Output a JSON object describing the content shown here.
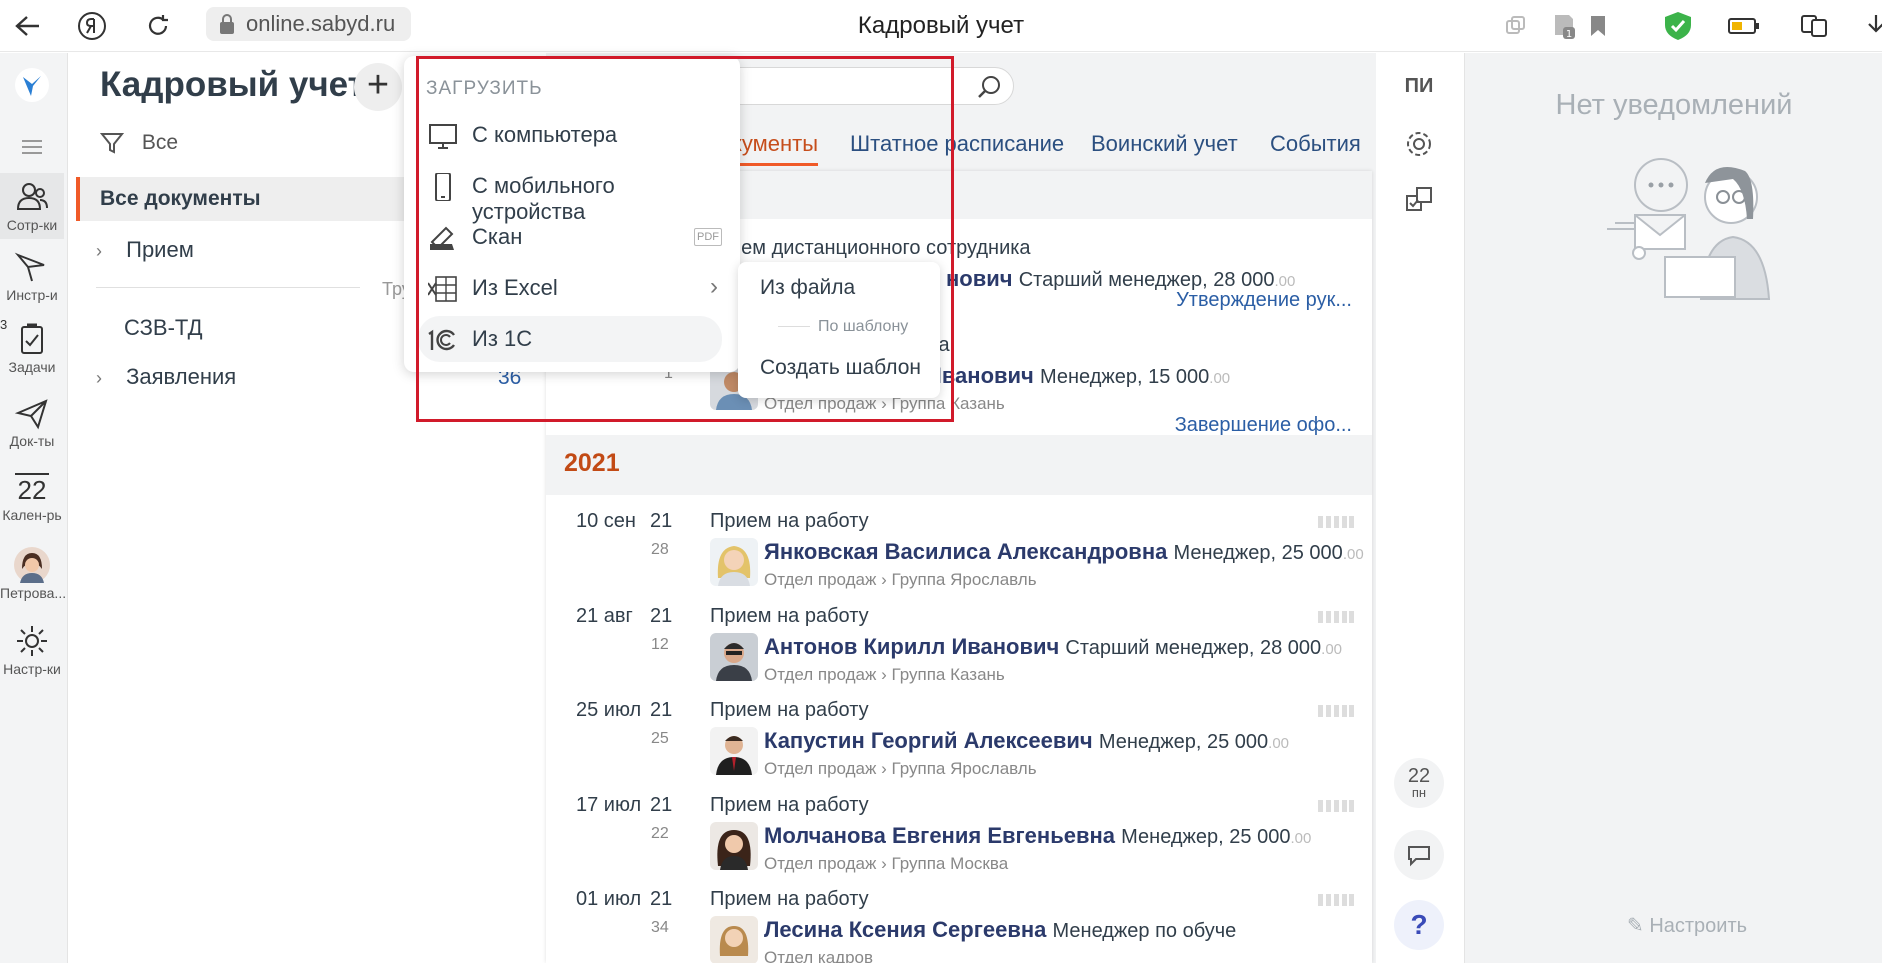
{
  "browser": {
    "url": "online.sabyd.ru",
    "title": "Кадровый учет"
  },
  "nav": {
    "items": [
      {
        "label": "Сотр-ки"
      },
      {
        "label": "Инстр-и"
      },
      {
        "label": "Задачи",
        "badge": "3"
      },
      {
        "label": "Док-ты"
      },
      {
        "label": "Кален-рь",
        "day": "22"
      },
      {
        "label": "Петрова..."
      },
      {
        "label": "Настр-ки"
      }
    ]
  },
  "sidebar": {
    "title": "Кадровый учет",
    "add_label": "+",
    "filter_label": "Все",
    "items": [
      {
        "label": "Все документы",
        "active": true
      },
      {
        "label": "Прием"
      },
      {
        "label": "СЗВ-ТД"
      },
      {
        "label": "Заявления",
        "count": "36"
      }
    ],
    "cut_label": "Тру"
  },
  "main": {
    "tabs": [
      {
        "label": "кументы",
        "active": true
      },
      {
        "label": "Штатное расписание"
      },
      {
        "label": "Воинский учет"
      },
      {
        "label": "События"
      }
    ],
    "top_rows": [
      {
        "type": "ием дистанционного сотрудника",
        "name": "нович",
        "position": "Старший менеджер, 28 000",
        "cents": ".00",
        "status": "Утверждение рук..."
      },
      {
        "type": "трудника",
        "number": "1",
        "name": "Иванович",
        "position": "Менеджер, 15 000",
        "cents": ".00",
        "dept": "Отдел продаж",
        "group": "Группа Казань",
        "status": "Завершение офо..."
      }
    ],
    "year": "2021",
    "documents": [
      {
        "date": "10 сен",
        "yr": "21",
        "num": "28",
        "type": "Прием на работу",
        "name": "Янковская Василиса Александровна",
        "position": "Менеджер, 25 000",
        "cents": ".00",
        "dept": "Отдел продаж",
        "group": "Группа Ярославль"
      },
      {
        "date": "21 авг",
        "yr": "21",
        "num": "12",
        "type": "Прием на работу",
        "name": "Антонов Кирилл Иванович",
        "position": "Старший менеджер, 28 000",
        "cents": ".00",
        "dept": "Отдел продаж",
        "group": "Группа Казань"
      },
      {
        "date": "25 июл",
        "yr": "21",
        "num": "25",
        "type": "Прием на работу",
        "name": "Капустин Георгий Алексеевич",
        "position": "Менеджер, 25 000",
        "cents": ".00",
        "dept": "Отдел продаж",
        "group": "Группа Ярославль"
      },
      {
        "date": "17 июл",
        "yr": "21",
        "num": "22",
        "type": "Прием на работу",
        "name": "Молчанова Евгения Евгеньевна",
        "position": "Менеджер, 25 000",
        "cents": ".00",
        "dept": "Отдел продаж",
        "group": "Группа Москва"
      },
      {
        "date": "01 июл",
        "yr": "21",
        "num": "34",
        "type": "Прием на работу",
        "name": "Лесина Ксения Сергеевна",
        "position": "Менеджер по обуче",
        "cents": "",
        "dept": "Отдел кадров",
        "group": ""
      }
    ]
  },
  "right_tools": {
    "user_initials": "ПИ",
    "calendar_day": "22",
    "calendar_weekday": "пн",
    "help_label": "?"
  },
  "notifications": {
    "empty_title": "Нет уведомлений",
    "configure_label": "Настроить"
  },
  "upload_menu": {
    "header": "ЗАГРУЗИТЬ",
    "items": [
      {
        "label": "С компьютера"
      },
      {
        "label": "С мобильного устройства"
      },
      {
        "label": "Скан",
        "hint": "PDF"
      },
      {
        "label": "Из Excel"
      },
      {
        "label": "Из 1С"
      }
    ],
    "submenu": {
      "from_file": "Из файла",
      "by_template": "По шаблону",
      "create_template": "Создать шаблон"
    }
  },
  "colors": {
    "accent": "#f05a28",
    "year": "#c24a15",
    "link": "#2b5ea5",
    "highlight_frame": "#d11a2a"
  }
}
